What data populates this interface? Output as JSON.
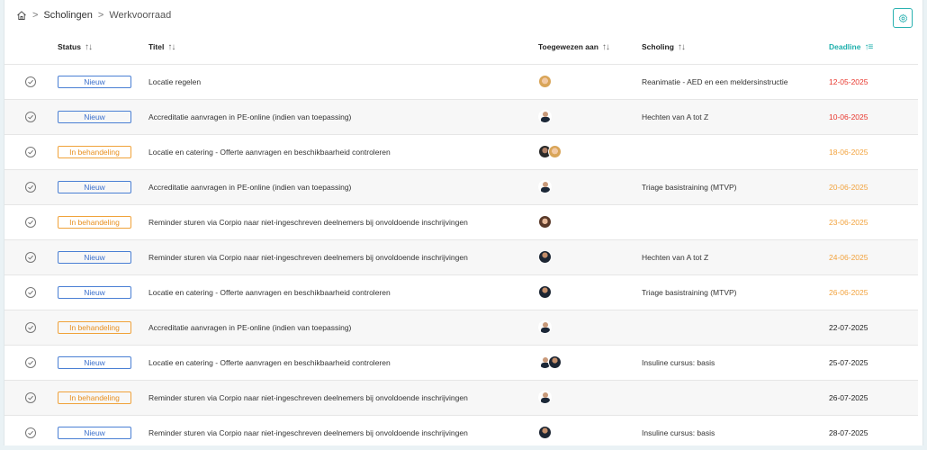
{
  "breadcrumb": {
    "home_icon": "home-icon",
    "items": [
      "Scholingen",
      "Werkvoorraad"
    ]
  },
  "toolbar": {
    "settings_icon": "gear-icon"
  },
  "columns": {
    "status": "Status",
    "titel": "Titel",
    "toegewezen": "Toegewezen aan",
    "scholing": "Scholing",
    "deadline": "Deadline"
  },
  "colors": {
    "accent": "#1fb0ad",
    "overdue": "#e8352b",
    "soon": "#f2a23c",
    "nieuw": "#3a6fcb",
    "behandeling": "#e89020"
  },
  "rows": [
    {
      "status": "Nieuw",
      "titel": "Locatie regelen",
      "scholing": "Reanimatie - AED en een meldersinstructie",
      "deadline": "12-05-2025",
      "deadline_state": "red",
      "avatars": [
        "blonde"
      ]
    },
    {
      "status": "Nieuw",
      "titel": "Accreditatie aanvragen in PE-online (indien van toepassing)",
      "scholing": "Hechten van A tot Z",
      "deadline": "10-06-2025",
      "deadline_state": "red",
      "avatars": [
        "suit"
      ]
    },
    {
      "status": "In behandeling",
      "titel": "Locatie en catering - Offerte aanvragen en beschikbaarheid controleren",
      "scholing": "",
      "deadline": "18-06-2025",
      "deadline_state": "orange",
      "avatars": [
        "dark",
        "blonde"
      ]
    },
    {
      "status": "Nieuw",
      "titel": "Accreditatie aanvragen in PE-online (indien van toepassing)",
      "scholing": "Triage basistraining (MTVP)",
      "deadline": "20-06-2025",
      "deadline_state": "orange",
      "avatars": [
        "suit"
      ]
    },
    {
      "status": "In behandeling",
      "titel": "Reminder sturen via Corpio naar niet-ingeschreven deelnemers bij onvoldoende inschrijvingen",
      "scholing": "",
      "deadline": "23-06-2025",
      "deadline_state": "orange",
      "avatars": [
        "woman"
      ]
    },
    {
      "status": "Nieuw",
      "titel": "Reminder sturen via Corpio naar niet-ingeschreven deelnemers bij onvoldoende inschrijvingen",
      "scholing": "Hechten van A tot Z",
      "deadline": "24-06-2025",
      "deadline_state": "orange",
      "avatars": [
        "man"
      ]
    },
    {
      "status": "Nieuw",
      "titel": "Locatie en catering - Offerte aanvragen en beschikbaarheid controleren",
      "scholing": "Triage basistraining (MTVP)",
      "deadline": "26-06-2025",
      "deadline_state": "orange",
      "avatars": [
        "man"
      ]
    },
    {
      "status": "In behandeling",
      "titel": "Accreditatie aanvragen in PE-online (indien van toepassing)",
      "scholing": "",
      "deadline": "22-07-2025",
      "deadline_state": "black",
      "avatars": [
        "suit"
      ]
    },
    {
      "status": "Nieuw",
      "titel": "Locatie en catering - Offerte aanvragen en beschikbaarheid controleren",
      "scholing": "Insuline cursus: basis",
      "deadline": "25-07-2025",
      "deadline_state": "black",
      "avatars": [
        "suit",
        "man"
      ]
    },
    {
      "status": "In behandeling",
      "titel": "Reminder sturen via Corpio naar niet-ingeschreven deelnemers bij onvoldoende inschrijvingen",
      "scholing": "",
      "deadline": "26-07-2025",
      "deadline_state": "black",
      "avatars": [
        "suit"
      ]
    },
    {
      "status": "Nieuw",
      "titel": "Reminder sturen via Corpio naar niet-ingeschreven deelnemers bij onvoldoende inschrijvingen",
      "scholing": "Insuline cursus: basis",
      "deadline": "28-07-2025",
      "deadline_state": "black",
      "avatars": [
        "man"
      ]
    }
  ]
}
